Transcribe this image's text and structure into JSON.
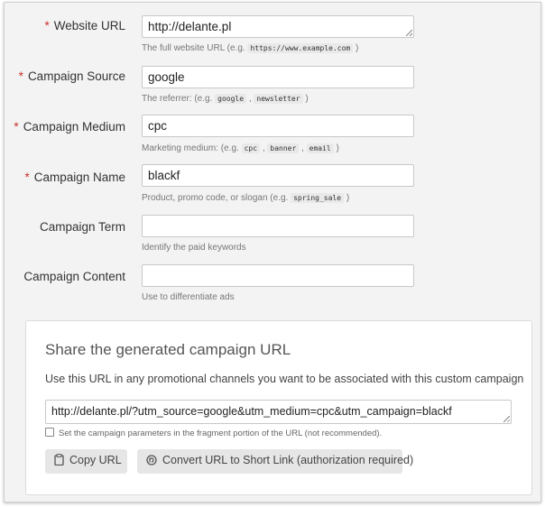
{
  "form": {
    "fields": [
      {
        "label": "Website URL",
        "required": true,
        "value": "http://delante.pl",
        "help_prefix": "The full website URL (e.g.",
        "help_codes": [
          "https://www.example.com"
        ],
        "help_suffix": ")"
      },
      {
        "label": "Campaign Source",
        "required": true,
        "value": "google",
        "help_prefix": "The referrer: (e.g.",
        "help_codes": [
          "google",
          "newsletter"
        ],
        "help_suffix": ")"
      },
      {
        "label": "Campaign Medium",
        "required": true,
        "value": "cpc",
        "help_prefix": "Marketing medium: (e.g.",
        "help_codes": [
          "cpc",
          "banner",
          "email"
        ],
        "help_suffix": ")"
      },
      {
        "label": "Campaign Name",
        "required": true,
        "value": "blackf",
        "help_prefix": "Product, promo code, or slogan (e.g.",
        "help_codes": [
          "spring_sale"
        ],
        "help_suffix": ")"
      },
      {
        "label": "Campaign Term",
        "required": false,
        "value": "",
        "help_prefix": "Identify the paid keywords",
        "help_codes": [],
        "help_suffix": ""
      },
      {
        "label": "Campaign Content",
        "required": false,
        "value": "",
        "help_prefix": "Use to differentiate ads",
        "help_codes": [],
        "help_suffix": ""
      }
    ],
    "required_marker": "*"
  },
  "share": {
    "title": "Share the generated campaign URL",
    "description": "Use this URL in any promotional channels you want to be associated with this custom campaign",
    "generated_url": "http://delante.pl/?utm_source=google&utm_medium=cpc&utm_campaign=blackf",
    "fragment_checkbox_label": "Set the campaign parameters in the fragment portion of the URL (not recommended).",
    "fragment_checked": false,
    "copy_button": {
      "label": "Copy URL",
      "icon": "clipboard-icon"
    },
    "shortlink_button": {
      "label": "Convert URL to Short Link (authorization required)",
      "icon": "link-icon"
    }
  },
  "colors": {
    "required": "#c9302c",
    "background": "#f3f3f3",
    "button": "#e6e6e6"
  }
}
